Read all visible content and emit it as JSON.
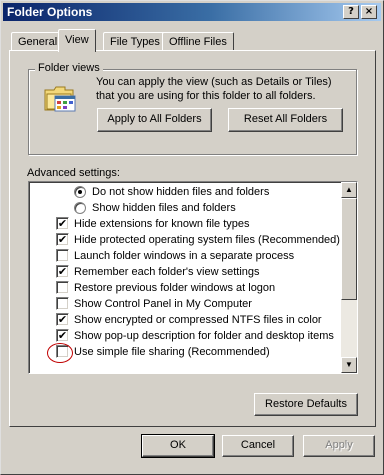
{
  "window": {
    "title": "Folder Options",
    "help_button": "?",
    "close_button": "×"
  },
  "tabs": [
    {
      "label": "General",
      "active": false
    },
    {
      "label": "View",
      "active": true
    },
    {
      "label": "File Types",
      "active": false
    },
    {
      "label": "Offline Files",
      "active": false
    }
  ],
  "folder_views": {
    "legend": "Folder views",
    "icon": "folder-views-icon",
    "description": "You can apply the view (such as Details or Tiles) that you are using for this folder to all folders.",
    "apply_button": "Apply to All Folders",
    "reset_button": "Reset All Folders"
  },
  "advanced": {
    "label": "Advanced settings:",
    "items": [
      {
        "type": "radio",
        "checked": true,
        "label": "Do not show hidden files and folders"
      },
      {
        "type": "radio",
        "checked": false,
        "label": "Show hidden files and folders"
      },
      {
        "type": "checkbox",
        "checked": true,
        "label": "Hide extensions for known file types"
      },
      {
        "type": "checkbox",
        "checked": true,
        "label": "Hide protected operating system files (Recommended)"
      },
      {
        "type": "checkbox",
        "checked": false,
        "label": "Launch folder windows in a separate process"
      },
      {
        "type": "checkbox",
        "checked": true,
        "label": "Remember each folder's view settings"
      },
      {
        "type": "checkbox",
        "checked": false,
        "label": "Restore previous folder windows at logon"
      },
      {
        "type": "checkbox",
        "checked": false,
        "label": "Show Control Panel in My Computer"
      },
      {
        "type": "checkbox",
        "checked": true,
        "label": "Show encrypted or compressed NTFS files in color"
      },
      {
        "type": "checkbox",
        "checked": true,
        "label": "Show pop-up description for folder and desktop items"
      },
      {
        "type": "checkbox",
        "checked": false,
        "label": "Use simple file sharing (Recommended)"
      }
    ],
    "check_glyph": "✔",
    "restore_defaults_button": "Restore Defaults"
  },
  "dialog_buttons": {
    "ok": "OK",
    "cancel": "Cancel",
    "apply": "Apply"
  },
  "colors": {
    "title_gradient_start": "#0a246a",
    "title_gradient_end": "#a6caf0",
    "face": "#d4d0c8",
    "highlight_oval": "#c00000"
  }
}
